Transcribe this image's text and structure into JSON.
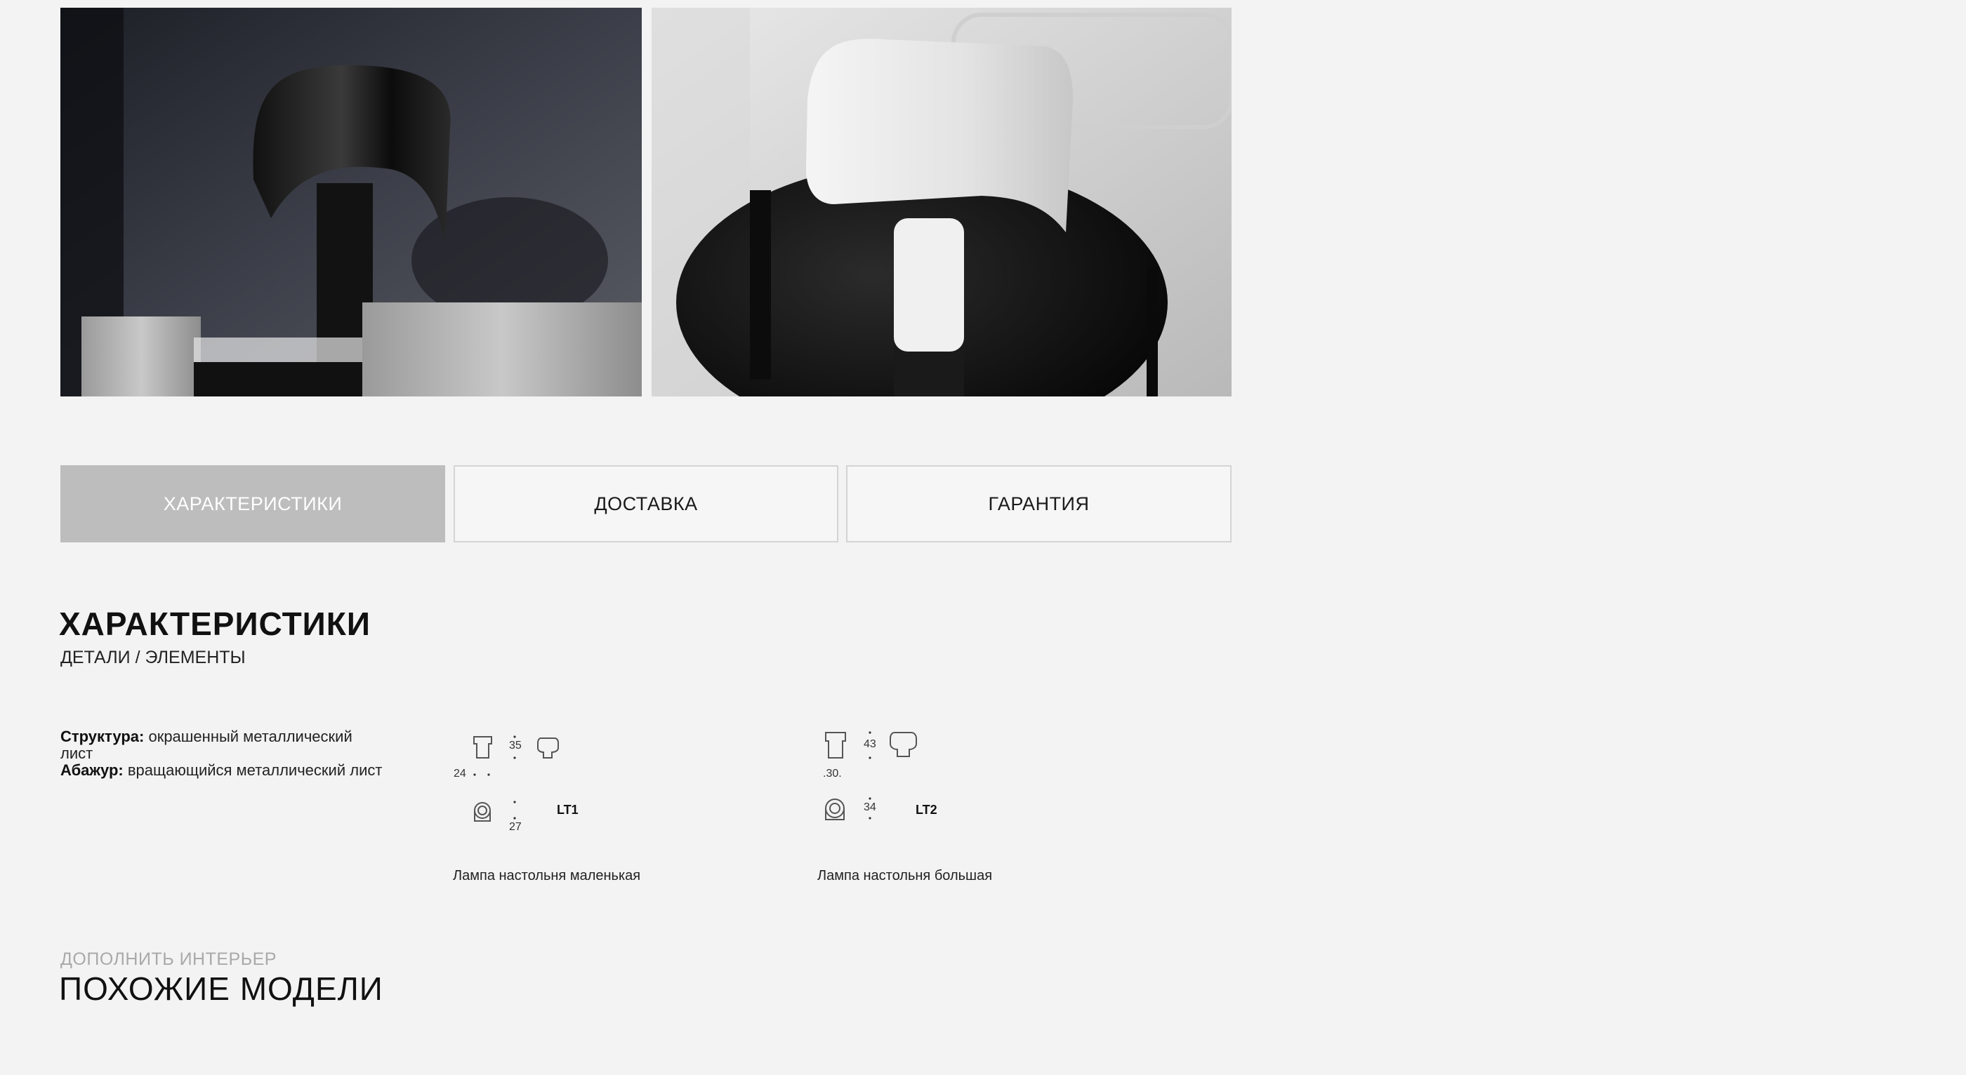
{
  "gallery": {
    "photos": [
      {
        "subject": "black table lamp on grey cabinet",
        "icon": "lamp-photo-black"
      },
      {
        "subject": "white table lamp on black round side table",
        "icon": "lamp-photo-white"
      }
    ]
  },
  "tabs": [
    {
      "label": "ХАРАКТЕРИСТИКИ",
      "active": true
    },
    {
      "label": "ДОСТАВКА",
      "active": false
    },
    {
      "label": "ГАРАНТИЯ",
      "active": false
    }
  ],
  "section": {
    "title": "ХАРАКТЕРИСТИКИ",
    "subtitle": "ДЕТАЛИ / ЭЛЕМЕНТЫ"
  },
  "specs": [
    {
      "label": "Структура:",
      "value": "окрашенный металлический лист"
    },
    {
      "label": "Абажур:",
      "value": "вращающийся металлический лист"
    }
  ],
  "variants": [
    {
      "code": "LT1",
      "height": "35",
      "width": "24",
      "depth": "27",
      "name": "Лампа настольня маленькая"
    },
    {
      "code": "LT2",
      "height": "43",
      "width": ".30.",
      "depth": "34",
      "name": "Лампа настольня большая"
    }
  ],
  "similar": {
    "eyebrow": "ДОПОЛНИТЬ ИНТЕРЬЕР",
    "title": "ПОХОЖИЕ МОДЕЛИ"
  },
  "colors": {
    "background": "#f3f3f3",
    "tab_active_bg": "#bdbdbd",
    "tab_border": "#d4d4d4",
    "text": "#111111",
    "muted": "#a9a9a9"
  }
}
